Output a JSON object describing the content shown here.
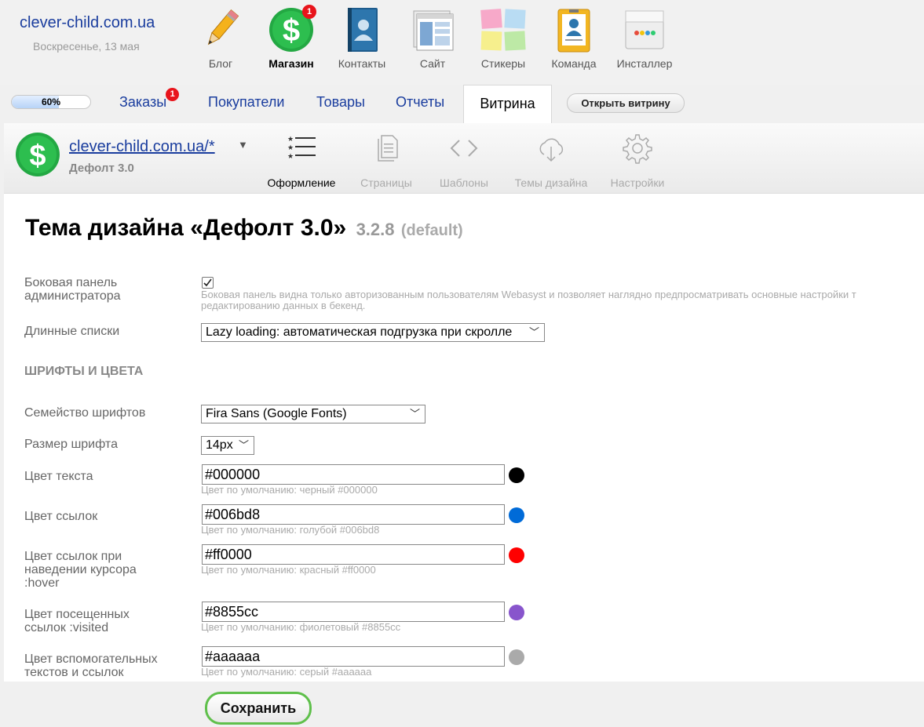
{
  "header": {
    "site_name": "clever-child.com.ua",
    "date": "Воскресенье, 13 мая",
    "apps": [
      {
        "label": "Блог",
        "icon": "pencil-icon"
      },
      {
        "label": "Магазин",
        "icon": "shop-dollar-icon",
        "badge": "1"
      },
      {
        "label": "Контакты",
        "icon": "contacts-book-icon"
      },
      {
        "label": "Сайт",
        "icon": "site-window-icon"
      },
      {
        "label": "Стикеры",
        "icon": "stickers-icon"
      },
      {
        "label": "Команда",
        "icon": "team-badge-icon"
      },
      {
        "label": "Инсталлер",
        "icon": "installer-box-icon"
      }
    ]
  },
  "nav": {
    "progress_label": "60%",
    "progress_value": 0.6,
    "tabs": [
      {
        "label": "Заказы",
        "badge": "1"
      },
      {
        "label": "Покупатели"
      },
      {
        "label": "Товары"
      },
      {
        "label": "Отчеты"
      },
      {
        "label": "Витрина"
      }
    ],
    "open_storefront": "Открыть витрину"
  },
  "store": {
    "url": "clever-child.com.ua/*",
    "theme_name": "Дефолт 3.0",
    "tabs": [
      {
        "label": "Оформление",
        "icon": "list-stars-icon"
      },
      {
        "label": "Страницы",
        "icon": "pages-icon"
      },
      {
        "label": "Шаблоны",
        "icon": "code-brackets-icon"
      },
      {
        "label": "Темы дизайна",
        "icon": "cloud-download-icon"
      },
      {
        "label": "Настройки",
        "icon": "gear-icon"
      }
    ]
  },
  "page": {
    "title": "Тема дизайна «Дефолт 3.0»",
    "version": "3.2.8",
    "default_tag": "(default)"
  },
  "settings": {
    "admin_panel_label": "Боковая панель администратора",
    "admin_panel_checked": true,
    "admin_panel_hint": "Боковая панель видна только авторизованным пользователям Webasyst и позволяет наглядно предпросматривать основные настройки т редактированию данных в бекенд.",
    "long_lists_label": "Длинные списки",
    "long_lists_value": "Lazy loading: автоматическая подгрузка при скролле",
    "section_fonts": "ШРИФТЫ И ЦВЕТА",
    "font_family_label": "Семейство шрифтов",
    "font_family_value": "Fira Sans (Google Fonts)",
    "font_size_label": "Размер шрифта",
    "font_size_value": "14px",
    "colors": [
      {
        "label": "Цвет текста",
        "value": "#000000",
        "hint": "Цвет по умолчанию: черный #000000",
        "swatch": "#000000"
      },
      {
        "label": "Цвет ссылок",
        "value": "#006bd8",
        "hint": "Цвет по умолчанию: голубой #006bd8",
        "swatch": "#006bd8"
      },
      {
        "label": "Цвет ссылок при наведении курсора :hover",
        "value": "#ff0000",
        "hint": "Цвет по умолчанию: красный #ff0000",
        "swatch": "#ff0000"
      },
      {
        "label": "Цвет посещенных ссылок :visited",
        "value": "#8855cc",
        "hint": "Цвет по умолчанию: фиолетовый #8855cc",
        "swatch": "#8855cc"
      },
      {
        "label": "Цвет вспомогательных текстов и ссылок",
        "value": "#aaaaaa",
        "hint": "Цвет по умолчанию: серый #aaaaaa",
        "swatch": "#aaaaaa"
      }
    ]
  },
  "footer": {
    "save_label": "Сохранить"
  }
}
